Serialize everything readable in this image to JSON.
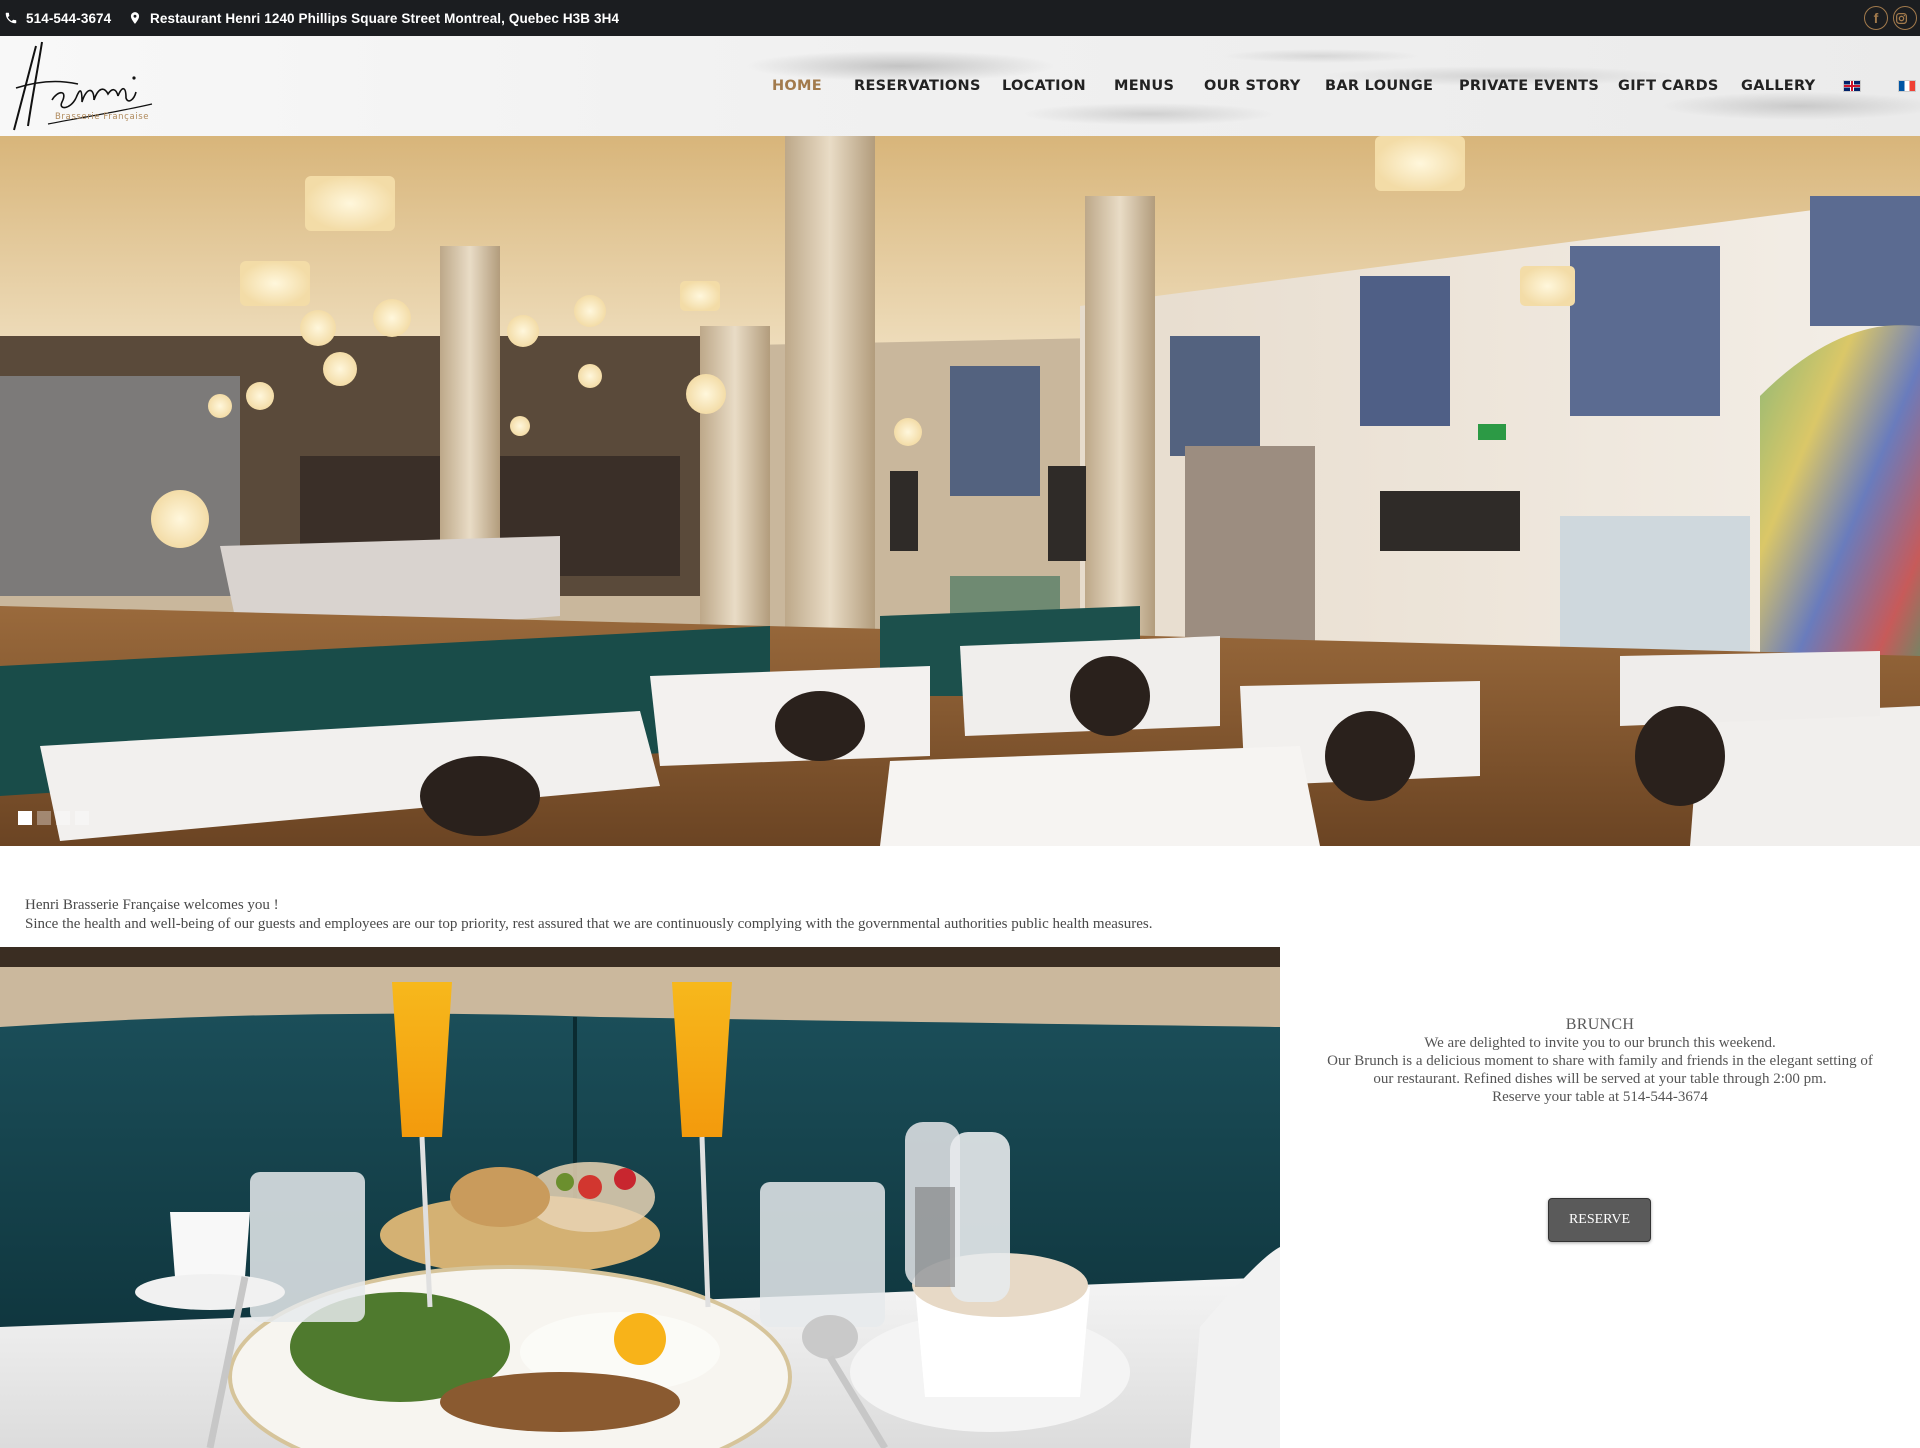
{
  "topbar": {
    "phone": "514-544-3674",
    "address": "Restaurant Henri 1240 Phillips Square Street Montreal, Quebec H3B 3H4",
    "social": [
      "facebook-icon",
      "instagram-icon"
    ],
    "accent_color": "#a27a4c"
  },
  "header": {
    "logo_text": "Henri",
    "logo_subtitle": "Brasserie Française",
    "nav": [
      "HOME",
      "RESERVATIONS",
      "LOCATION",
      "MENUS",
      "OUR STORY",
      "BAR LOUNGE",
      "PRIVATE EVENTS",
      "GIFT CARDS",
      "GALLERY"
    ],
    "active_nav": "HOME",
    "languages": [
      "english-flag-icon",
      "french-flag-icon"
    ]
  },
  "hero": {
    "slide_count": 4,
    "active_slide": 1
  },
  "welcome": {
    "line1": "Henri Brasserie Française  welcomes you  !",
    "line2": "Since the health and well-being of our guests and employees are our top priority, rest assured that we are continuously complying with the governmental authorities public health measures."
  },
  "brunch": {
    "title": "BRUNCH",
    "line1": "We are delighted to invite you to our  brunch this weekend.",
    "line2": "Our Brunch is a delicious moment to share with family and friends in the elegant setting of",
    "line3": "our restaurant. Refined dishes will be served at your table through 2:00 pm.",
    "line4": "Reserve your table at 514-544-3674",
    "button_label": "RESERVE"
  }
}
